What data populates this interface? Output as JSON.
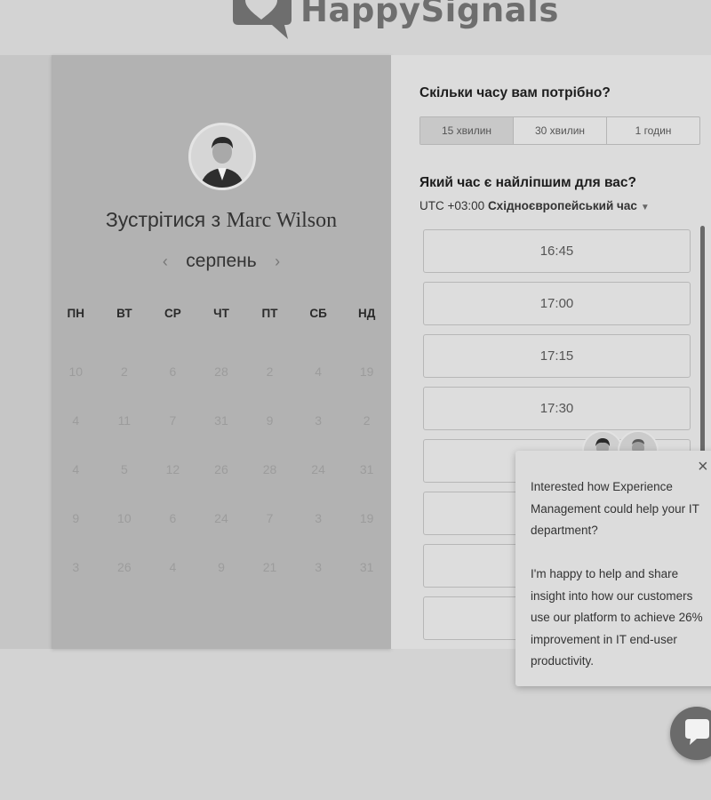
{
  "brand": {
    "name": "HappySignals"
  },
  "host": {
    "prefix": "Зустрітися з",
    "name": "Marc Wilson"
  },
  "calendar": {
    "month": "серпень",
    "weekdays": [
      "ПН",
      "ВТ",
      "СР",
      "ЧТ",
      "ПТ",
      "СБ",
      "НД"
    ],
    "weeks": [
      [
        "10",
        "2",
        "6",
        "28",
        "2",
        "4",
        "19"
      ],
      [
        "4",
        "11",
        "7",
        "31",
        "9",
        "3",
        "2"
      ],
      [
        "4",
        "5",
        "12",
        "26",
        "28",
        "24",
        "31"
      ],
      [
        "9",
        "10",
        "6",
        "24",
        "7",
        "3",
        "19"
      ],
      [
        "3",
        "26",
        "4",
        "9",
        "21",
        "3",
        "31"
      ]
    ]
  },
  "duration": {
    "title": "Скільки часу вам потрібно?",
    "options": [
      "15 хвилин",
      "30 хвилин",
      "1 годин"
    ],
    "selected": "15 хвилин"
  },
  "time_selection": {
    "title": "Який час є найліпшим для вас?",
    "timezone_offset": "UTC +03:00",
    "timezone_name": "Східноєвропейський час",
    "slots": [
      "16:45",
      "17:00",
      "17:15",
      "17:30",
      "",
      "",
      "",
      ""
    ]
  },
  "popup": {
    "message_1": "Interested how Experience Management could help your IT department?",
    "message_2": "I'm happy to help and share insight into how our customers use our platform to achieve 26% improvement in IT end-user productivity.",
    "close_glyph": "×"
  },
  "icons": {
    "logo": "speech-bubble-heart-icon",
    "prev": "chevron-left-icon",
    "next": "chevron-right-icon",
    "caret": "caret-down-icon",
    "close": "close-icon",
    "chat": "chat-bubble-icon"
  },
  "colors": {
    "left_panel": "#b2b2b2",
    "right_panel": "#dcdcdc",
    "logo": "#6e6e6e",
    "chat_button": "#6b6b6b"
  }
}
